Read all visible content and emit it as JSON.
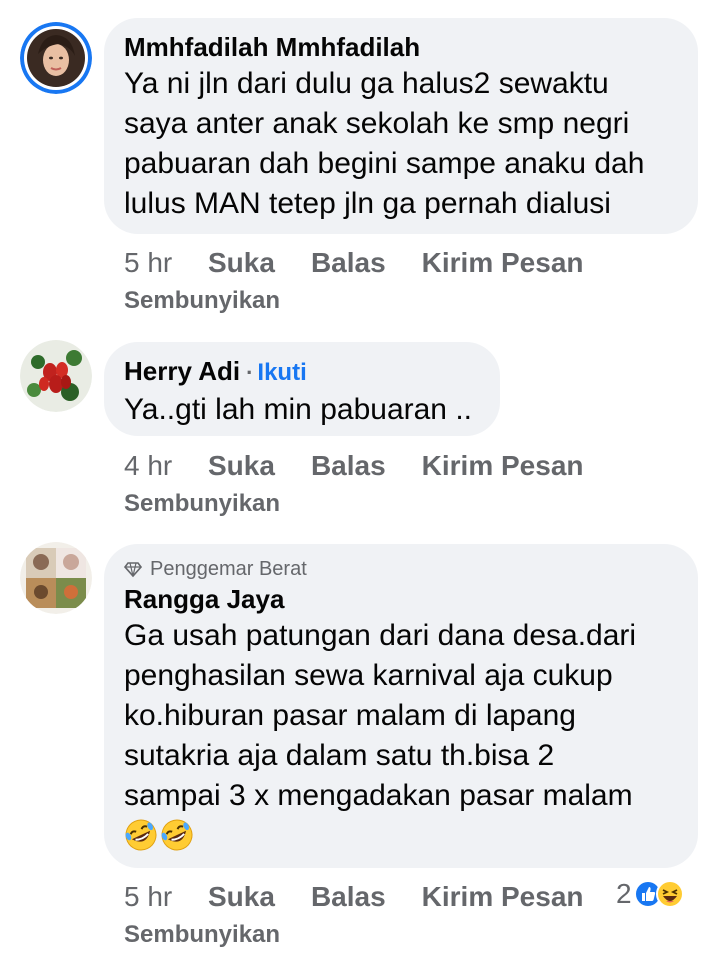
{
  "comments": [
    {
      "author": "Mmhfadilah Mmhfadilah",
      "text": "Ya ni jln dari dulu ga halus2 sewaktu\nsaya anter anak sekolah ke smp  negri\npabuaran dah begini sampe anaku dah\nlulus MAN tetep jln ga pernah dialusi",
      "time": "5 hr",
      "like": "Suka",
      "reply": "Balas",
      "message": "Kirim Pesan",
      "hide": "Sembunyikan",
      "avatar_icon": "profile-photo-woman"
    },
    {
      "author": "Herry Adi",
      "follow_sep": "·",
      "follow": "Ikuti",
      "text": "Ya..gti lah min pabuaran ..",
      "time": "4 hr",
      "like": "Suka",
      "reply": "Balas",
      "message": "Kirim Pesan",
      "hide": "Sembunyikan",
      "avatar_icon": "profile-photo-red-berries"
    },
    {
      "badge": "Penggemar Berat",
      "badge_icon": "diamond-icon",
      "author": "Rangga Jaya",
      "text": "Ga usah patungan dari dana desa.dari\npenghasilan sewa karnival aja cukup\nko.hiburan pasar malam di lapang\nsutakria aja dalam satu th.bisa 2\nsampai 3 x mengadakan pasar malam",
      "emojis": [
        "rolling-on-floor-laughing-emoji",
        "rolling-on-floor-laughing-emoji"
      ],
      "time": "5 hr",
      "like": "Suka",
      "reply": "Balas",
      "message": "Kirim Pesan",
      "hide": "Sembunyikan",
      "reaction_count": "2",
      "reaction_icons": [
        "like-reaction-icon",
        "haha-reaction-icon"
      ],
      "avatar_icon": "profile-photo-collage"
    }
  ],
  "colors": {
    "bubble": "#f0f2f5",
    "text": "#050505",
    "secondary": "#65676b",
    "link": "#1877f2",
    "avatar_ring": "#1877f2"
  }
}
